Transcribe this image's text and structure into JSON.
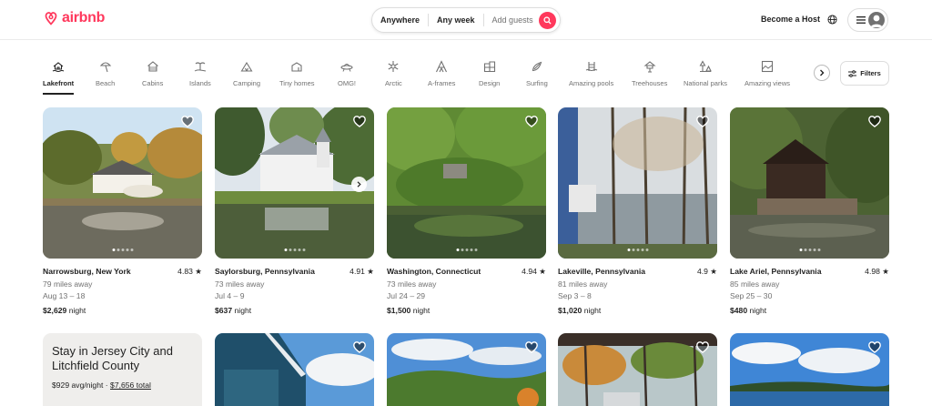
{
  "header": {
    "logo_text": "airbnb",
    "search": {
      "anywhere": "Anywhere",
      "any_week": "Any week",
      "guests": "Add guests"
    },
    "become_host": "Become a Host"
  },
  "categories": [
    {
      "label": "Lakefront",
      "icon": "lakefront-icon",
      "active": true
    },
    {
      "label": "Beach",
      "icon": "beach-umbrella-icon"
    },
    {
      "label": "Cabins",
      "icon": "cabin-icon"
    },
    {
      "label": "Islands",
      "icon": "island-icon"
    },
    {
      "label": "Camping",
      "icon": "tent-icon"
    },
    {
      "label": "Tiny homes",
      "icon": "tiny-home-icon"
    },
    {
      "label": "OMG!",
      "icon": "ufo-icon"
    },
    {
      "label": "Arctic",
      "icon": "snowflake-icon"
    },
    {
      "label": "A-frames",
      "icon": "a-frame-icon"
    },
    {
      "label": "Design",
      "icon": "design-icon"
    },
    {
      "label": "Surfing",
      "icon": "surfboard-icon"
    },
    {
      "label": "Amazing pools",
      "icon": "pool-icon"
    },
    {
      "label": "Treehouses",
      "icon": "treehouse-icon"
    },
    {
      "label": "National parks",
      "icon": "national-park-icon"
    },
    {
      "label": "Amazing views",
      "icon": "views-icon"
    }
  ],
  "filters_label": "Filters",
  "listings": [
    {
      "location": "Narrowsburg, New York",
      "rating": "4.83",
      "distance": "79 miles away",
      "dates": "Aug 13 – 18",
      "price": "$2,629",
      "price_unit": "night"
    },
    {
      "location": "Saylorsburg, Pennsylvania",
      "rating": "4.91",
      "distance": "73 miles away",
      "dates": "Jul 4 – 9",
      "price": "$637",
      "price_unit": "night"
    },
    {
      "location": "Washington, Connecticut",
      "rating": "4.94",
      "distance": "73 miles away",
      "dates": "Jul 24 – 29",
      "price": "$1,500",
      "price_unit": "night"
    },
    {
      "location": "Lakeville, Pennsylvania",
      "rating": "4.9",
      "distance": "81 miles away",
      "dates": "Sep 3 – 8",
      "price": "$1,020",
      "price_unit": "night"
    },
    {
      "location": "Lake Ariel, Pennsylvania",
      "rating": "4.98",
      "distance": "85 miles away",
      "dates": "Sep 25 – 30",
      "price": "$480",
      "price_unit": "night"
    }
  ],
  "promo": {
    "title": "Stay in Jersey City and Litchfield County",
    "avg_price": "$929 avg/night",
    "separator": "·",
    "total": "$7,656 total"
  },
  "colors": {
    "brand": "#ff385c",
    "text": "#222222",
    "muted": "#717171"
  }
}
